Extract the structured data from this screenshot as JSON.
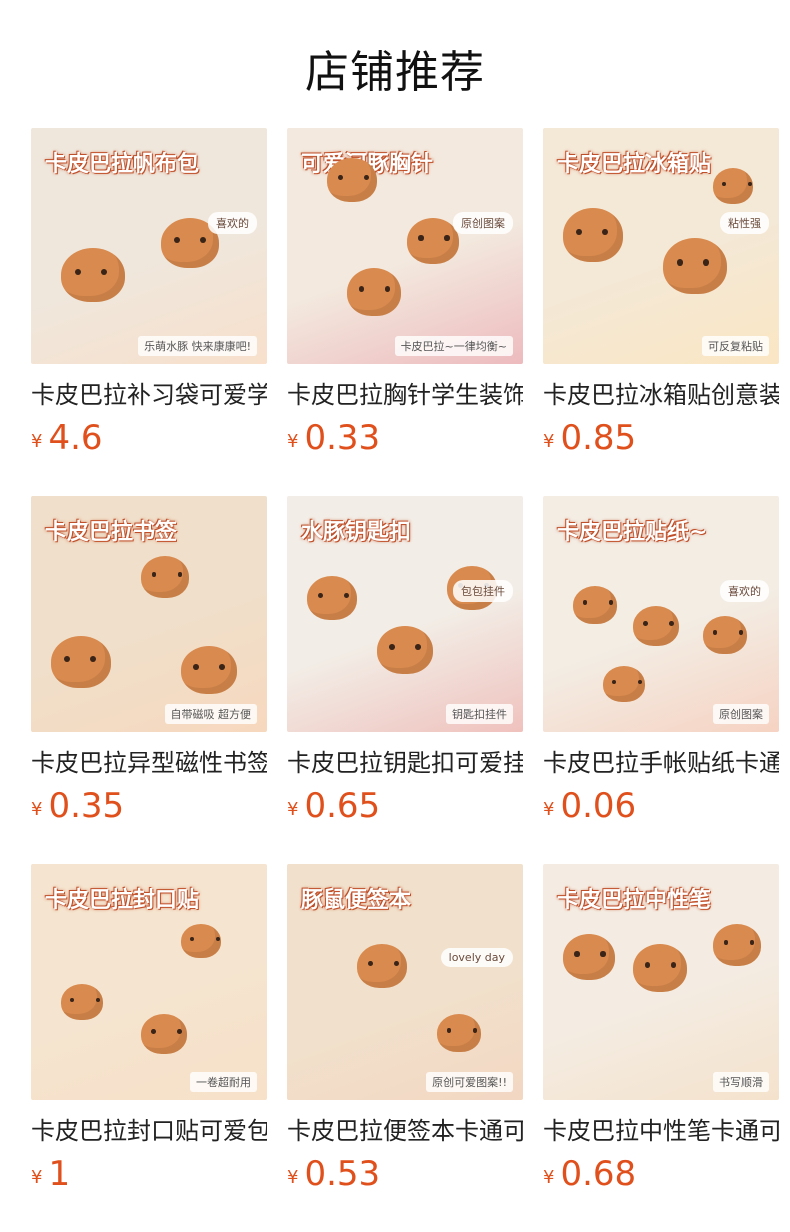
{
  "header": {
    "title": "店铺推荐"
  },
  "products": [
    {
      "name": "卡皮巴拉补习袋可爱学生",
      "currency": "¥",
      "price": "4.6",
      "banner": "卡皮巴拉帆布包",
      "bg": "#efe7dc",
      "accent": "#e9a064",
      "tag": "喜欢的",
      "chip": "乐萌水豚 快来康康吧!"
    },
    {
      "name": "卡皮巴拉胸针学生装饰",
      "currency": "¥",
      "price": "0.33",
      "banner": "可爱河豚胸针",
      "bg": "#f3e9de",
      "accent": "#c8323a",
      "tag": "原创图案",
      "chip": "卡皮巴拉~一律均衡~"
    },
    {
      "name": "卡皮巴拉冰箱贴创意装饰",
      "currency": "¥",
      "price": "0.85",
      "banner": "卡皮巴拉冰箱贴",
      "bg": "#f4e8d6",
      "accent": "#f0b54a",
      "tag": "粘性强",
      "chip": "可反复粘贴"
    },
    {
      "name": "卡皮巴拉异型磁性书签",
      "currency": "¥",
      "price": "0.35",
      "banner": "卡皮巴拉书签",
      "bg": "#f0dfca",
      "accent": "#e68a3c",
      "tag": "",
      "chip": "自带磁吸 超方便"
    },
    {
      "name": "卡皮巴拉钥匙扣可爱挂件",
      "currency": "¥",
      "price": "0.65",
      "banner": "水豚钥匙扣",
      "bg": "#f2ede6",
      "accent": "#d0463a",
      "tag": "包包挂件",
      "chip": "钥匙扣挂件"
    },
    {
      "name": "卡皮巴拉手帐贴纸卡通",
      "currency": "¥",
      "price": "0.06",
      "banner": "卡皮巴拉贴纸~",
      "bg": "#f3ede4",
      "accent": "#e37a4a",
      "tag": "喜欢的",
      "chip": "原创图案"
    },
    {
      "name": "卡皮巴拉封口贴可爱包装",
      "currency": "¥",
      "price": "1",
      "banner": "卡皮巴拉封口贴",
      "bg": "#f5e4cf",
      "accent": "#e7a45c",
      "tag": "",
      "chip": "一卷超耐用"
    },
    {
      "name": "卡皮巴拉便签本卡通可爱",
      "currency": "¥",
      "price": "0.53",
      "banner": "豚鼠便签本",
      "bg": "#f1e1cc",
      "accent": "#d9884a",
      "tag": "lovely day",
      "chip": "原创可爱图案!!"
    },
    {
      "name": "卡皮巴拉中性笔卡通可爱",
      "currency": "¥",
      "price": "0.68",
      "banner": "卡皮巴拉中性笔",
      "bg": "#f4ece2",
      "accent": "#e0a867",
      "tag": "",
      "chip": "书写顺滑"
    }
  ]
}
